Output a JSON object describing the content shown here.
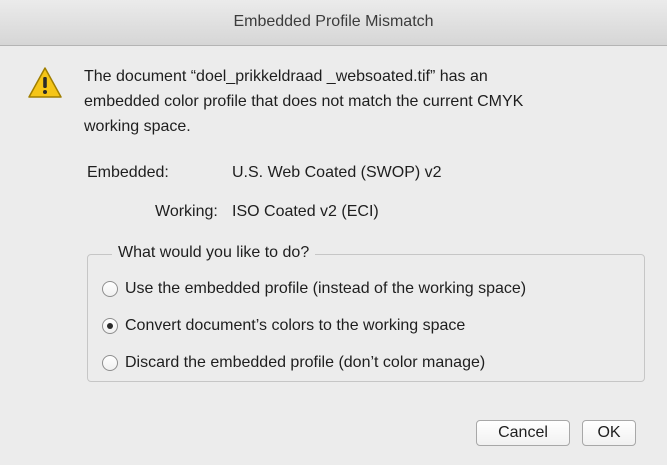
{
  "window": {
    "title": "Embedded Profile Mismatch"
  },
  "message": {
    "lines": [
      "The document “doel_prikkeldraad _websoated.tif” has an",
      "embedded color profile that does not match the current CMYK",
      "working space."
    ],
    "icon": "warning-triangle-icon"
  },
  "profiles": {
    "embedded_label": "Embedded:",
    "embedded_value": "U.S. Web Coated (SWOP) v2",
    "working_label": "Working:",
    "working_value": "ISO Coated v2 (ECI)"
  },
  "options": {
    "legend": "What would you like to do?",
    "items": [
      {
        "label": "Use the embedded profile (instead of the working space)",
        "selected": false
      },
      {
        "label": "Convert document’s colors to the working space",
        "selected": true
      },
      {
        "label": "Discard the embedded profile (don’t color manage)",
        "selected": false
      }
    ]
  },
  "buttons": {
    "cancel": "Cancel",
    "ok": "OK"
  },
  "colors": {
    "warning_fill": "#f5c518",
    "warning_stroke": "#a07e00",
    "dialog_bg": "#ececec"
  }
}
